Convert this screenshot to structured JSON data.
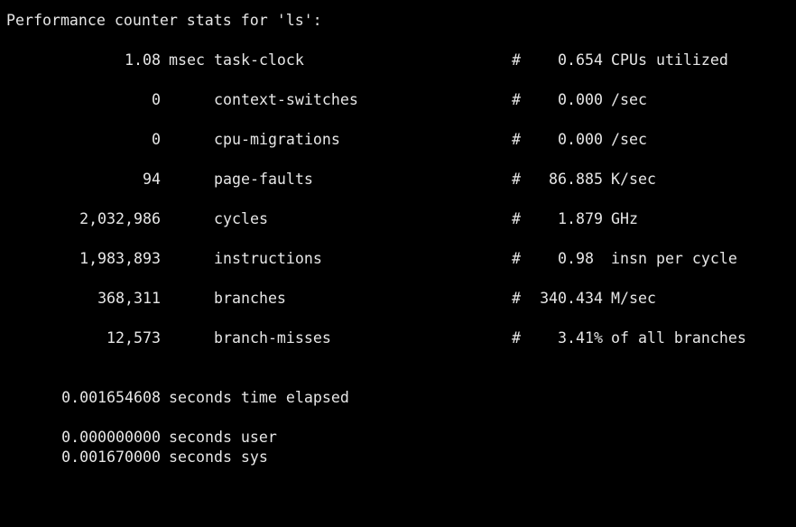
{
  "terminal": {
    "header": "Performance counter stats for 'ls':",
    "stats": [
      {
        "value": "1.08",
        "unit": "msec",
        "event": "task-clock",
        "hash": "#",
        "metric_value": "0.654",
        "metric_unit": "CPUs utilized"
      },
      {
        "value": "0",
        "unit": "",
        "event": "context-switches",
        "hash": "#",
        "metric_value": "0.000",
        "metric_unit": "/sec"
      },
      {
        "value": "0",
        "unit": "",
        "event": "cpu-migrations",
        "hash": "#",
        "metric_value": "0.000",
        "metric_unit": "/sec"
      },
      {
        "value": "94",
        "unit": "",
        "event": "page-faults",
        "hash": "#",
        "metric_value": "86.885",
        "metric_unit": "K/sec"
      },
      {
        "value": "2,032,986",
        "unit": "",
        "event": "cycles",
        "hash": "#",
        "metric_value": "1.879",
        "metric_unit": "GHz"
      },
      {
        "value": "1,983,893",
        "unit": "",
        "event": "instructions",
        "hash": "#",
        "metric_value": "0.98 ",
        "metric_unit": "insn per cycle"
      },
      {
        "value": "368,311",
        "unit": "",
        "event": "branches",
        "hash": "#",
        "metric_value": "340.434",
        "metric_unit": "M/sec"
      },
      {
        "value": "12,573",
        "unit": "",
        "event": "branch-misses",
        "hash": "#",
        "metric_value": "3.41%",
        "metric_unit": "of all branches"
      }
    ],
    "timing": {
      "elapsed_value": "0.001654608",
      "elapsed_label": "seconds time elapsed",
      "user_value": "0.000000000",
      "user_label": "seconds user",
      "sys_value": "0.001670000",
      "sys_label": "seconds sys"
    }
  }
}
